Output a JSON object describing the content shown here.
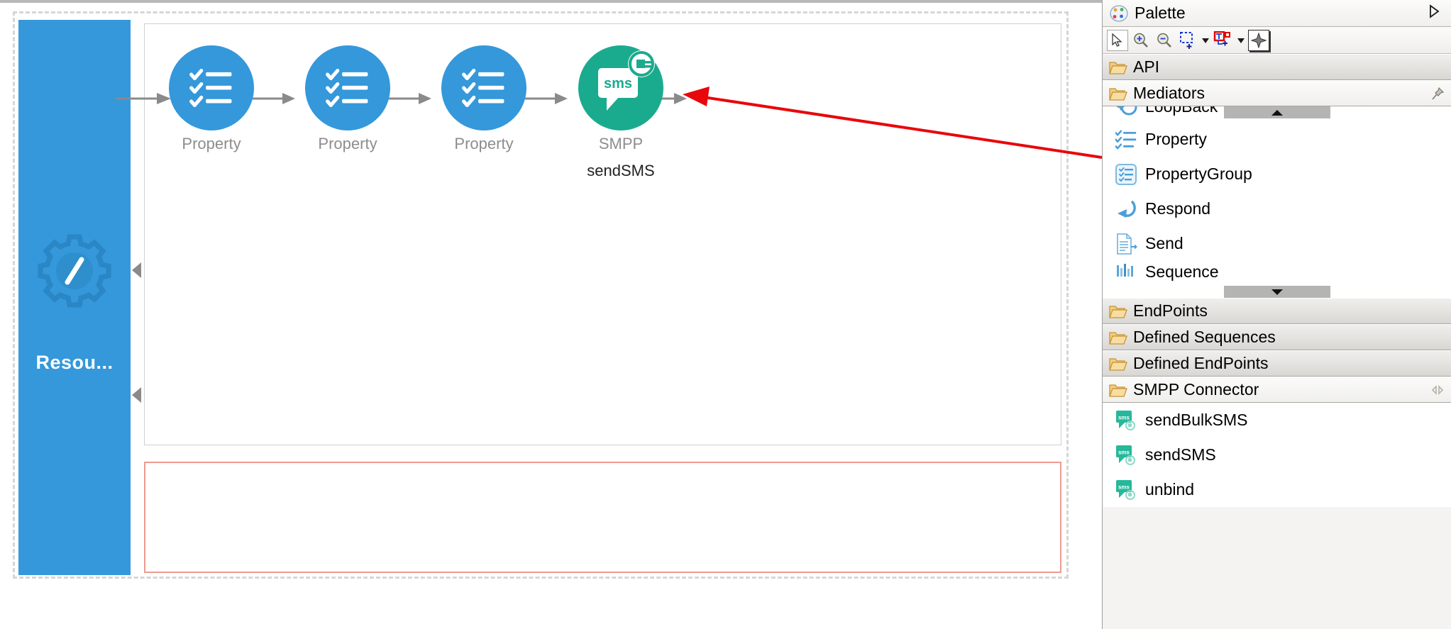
{
  "canvas": {
    "resource": {
      "label": "Resou...",
      "icon": "gear-slash-icon",
      "color": "#3498db"
    },
    "nodes": [
      {
        "id": "property-1",
        "label": "Property",
        "sublabel": "",
        "icon": "property-checklist-icon",
        "color": "#3498db",
        "type": "mediator"
      },
      {
        "id": "property-2",
        "label": "Property",
        "sublabel": "",
        "icon": "property-checklist-icon",
        "color": "#3498db",
        "type": "mediator"
      },
      {
        "id": "property-3",
        "label": "Property",
        "sublabel": "",
        "icon": "property-checklist-icon",
        "color": "#3498db",
        "type": "mediator"
      },
      {
        "id": "smpp-sendsms",
        "label": "SMPP",
        "sublabel": "sendSMS",
        "icon": "sms-connector-icon",
        "color": "#1aab8e",
        "type": "connector"
      }
    ],
    "fault_sequence": {
      "border_color": "#ef9a90"
    },
    "annotation": {
      "color": "#e8070b",
      "type": "arrow"
    }
  },
  "palette": {
    "title": "Palette",
    "minimize_icon": "triangle-right-icon",
    "palette_icon": "palette-icon",
    "toolbar": [
      {
        "name": "select-tool",
        "icon": "arrow-cursor-icon",
        "state": "pressed"
      },
      {
        "name": "zoom-in-tool",
        "icon": "magnifier-plus-icon",
        "state": "normal"
      },
      {
        "name": "zoom-out-tool",
        "icon": "magnifier-minus-icon",
        "state": "normal"
      },
      {
        "name": "marquee-tool",
        "icon": "marquee-select-icon",
        "state": "normal"
      },
      {
        "name": "marquee-dropdown",
        "icon": "caret-down-icon",
        "state": "normal"
      },
      {
        "name": "connection-tool",
        "icon": "connection-create-icon",
        "state": "normal"
      },
      {
        "name": "connection-dropdown",
        "icon": "caret-down-icon",
        "state": "normal"
      },
      {
        "name": "snap-tool",
        "icon": "diamond-star-icon",
        "state": "pressed-dark"
      }
    ],
    "drawers": [
      {
        "id": "api",
        "label": "API",
        "icon": "folder-open-icon",
        "expanded": false,
        "pinned": false,
        "items": []
      },
      {
        "id": "mediators",
        "label": "Mediators",
        "icon": "folder-open-icon",
        "expanded": true,
        "pinned": true,
        "pin_icon": "pin-icon",
        "scroll_up": true,
        "scroll_down": true,
        "items": [
          {
            "label": "LoopBack",
            "icon": "loopback-icon",
            "clipped": true
          },
          {
            "label": "Property",
            "icon": "property-checklist-icon",
            "clipped": false
          },
          {
            "label": "PropertyGroup",
            "icon": "property-group-icon",
            "clipped": false
          },
          {
            "label": "Respond",
            "icon": "respond-arrow-icon",
            "clipped": false
          },
          {
            "label": "Send",
            "icon": "send-document-icon",
            "clipped": false
          },
          {
            "label": "Sequence",
            "icon": "sequence-icon",
            "clipped": true
          }
        ]
      },
      {
        "id": "endpoints",
        "label": "EndPoints",
        "icon": "folder-open-icon",
        "expanded": false,
        "pinned": false,
        "items": []
      },
      {
        "id": "defined-sequences",
        "label": "Defined Sequences",
        "icon": "folder-open-icon",
        "expanded": false,
        "pinned": false,
        "items": []
      },
      {
        "id": "defined-endpoints",
        "label": "Defined EndPoints",
        "icon": "folder-open-icon",
        "expanded": false,
        "pinned": false,
        "items": []
      },
      {
        "id": "smpp-connector",
        "label": "SMPP Connector",
        "icon": "folder-open-icon",
        "expanded": true,
        "pinned": false,
        "pin_icon": "unpin-icon",
        "items": [
          {
            "label": "sendBulkSMS",
            "icon": "sms-connector-icon",
            "clipped": false
          },
          {
            "label": "sendSMS",
            "icon": "sms-connector-icon",
            "clipped": false
          },
          {
            "label": "unbind",
            "icon": "sms-connector-icon",
            "clipped": false
          }
        ]
      }
    ]
  },
  "colors": {
    "mediator_blue": "#3498db",
    "connector_teal": "#1aab8e",
    "annotation_red": "#e8070b",
    "fault_border": "#ef9a90",
    "icon_blue": "#4a9fd8",
    "folder_gold": "#e0a93a"
  }
}
